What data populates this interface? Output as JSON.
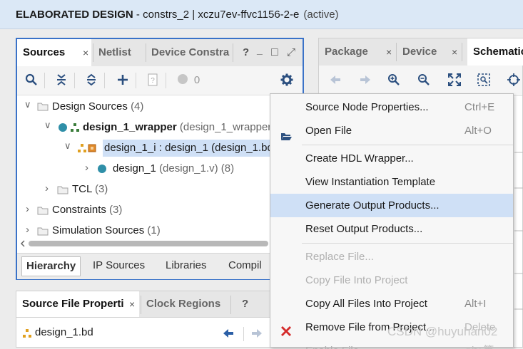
{
  "titlebar": {
    "mode": "ELABORATED DESIGN",
    "details": " - constrs_2 | xczu7ev-ffvc1156-2-e",
    "state": "(active)"
  },
  "sources_panel": {
    "tabs": [
      "Sources",
      "Netlist",
      "Device Constra"
    ],
    "tab_close": "×",
    "window_controls": [
      "?",
      "_",
      "□",
      "⤢"
    ],
    "toolbar": {
      "count": "0"
    },
    "tree": {
      "design_sources": {
        "label": "Design Sources",
        "count": "(4)"
      },
      "wrapper": {
        "label": "design_1_wrapper",
        "file": "(design_1_wrapper."
      },
      "inst": {
        "label": "design_1_i : design_1 (design_1.bd)"
      },
      "design": {
        "label": "design_1",
        "file": "(design_1.v) (8)"
      },
      "tcl": {
        "label": "TCL",
        "count": "(3)"
      },
      "constraints": {
        "label": "Constraints",
        "count": "(3)"
      },
      "sim": {
        "label": "Simulation Sources",
        "count": "(1)"
      }
    },
    "bottom_tabs": [
      "Hierarchy",
      "IP Sources",
      "Libraries",
      "Compil"
    ]
  },
  "right_panel": {
    "tabs": [
      "Package",
      "Device",
      "Schematic"
    ],
    "tab_close": "×"
  },
  "sfp": {
    "tabs": [
      "Source File Properti",
      "Clock Regions"
    ],
    "tab_close": "×",
    "help": "?",
    "file": "design_1.bd"
  },
  "menu": {
    "items": [
      {
        "label": "Source Node Properties...",
        "shortcut": "Ctrl+E"
      },
      {
        "label": "Open File",
        "shortcut": "Alt+O"
      },
      {
        "label": "Create HDL Wrapper...",
        "shortcut": ""
      },
      {
        "label": "View Instantiation Template",
        "shortcut": ""
      },
      {
        "label": "Generate Output Products...",
        "shortcut": ""
      },
      {
        "label": "Reset Output Products...",
        "shortcut": ""
      },
      {
        "label": "Replace File...",
        "shortcut": ""
      },
      {
        "label": "Copy File Into Project",
        "shortcut": ""
      },
      {
        "label": "Copy All Files Into Project",
        "shortcut": "Alt+I"
      },
      {
        "label": "Remove File from Project...",
        "shortcut": "Delete"
      },
      {
        "label": "Enable File",
        "shortcut": "Alt+等"
      }
    ]
  },
  "watermark": "CSDN @huyuhan02",
  "colors": {
    "accent": "#3a72c8",
    "highlight": "#cfe0f6",
    "remove": "#d42a2a"
  }
}
